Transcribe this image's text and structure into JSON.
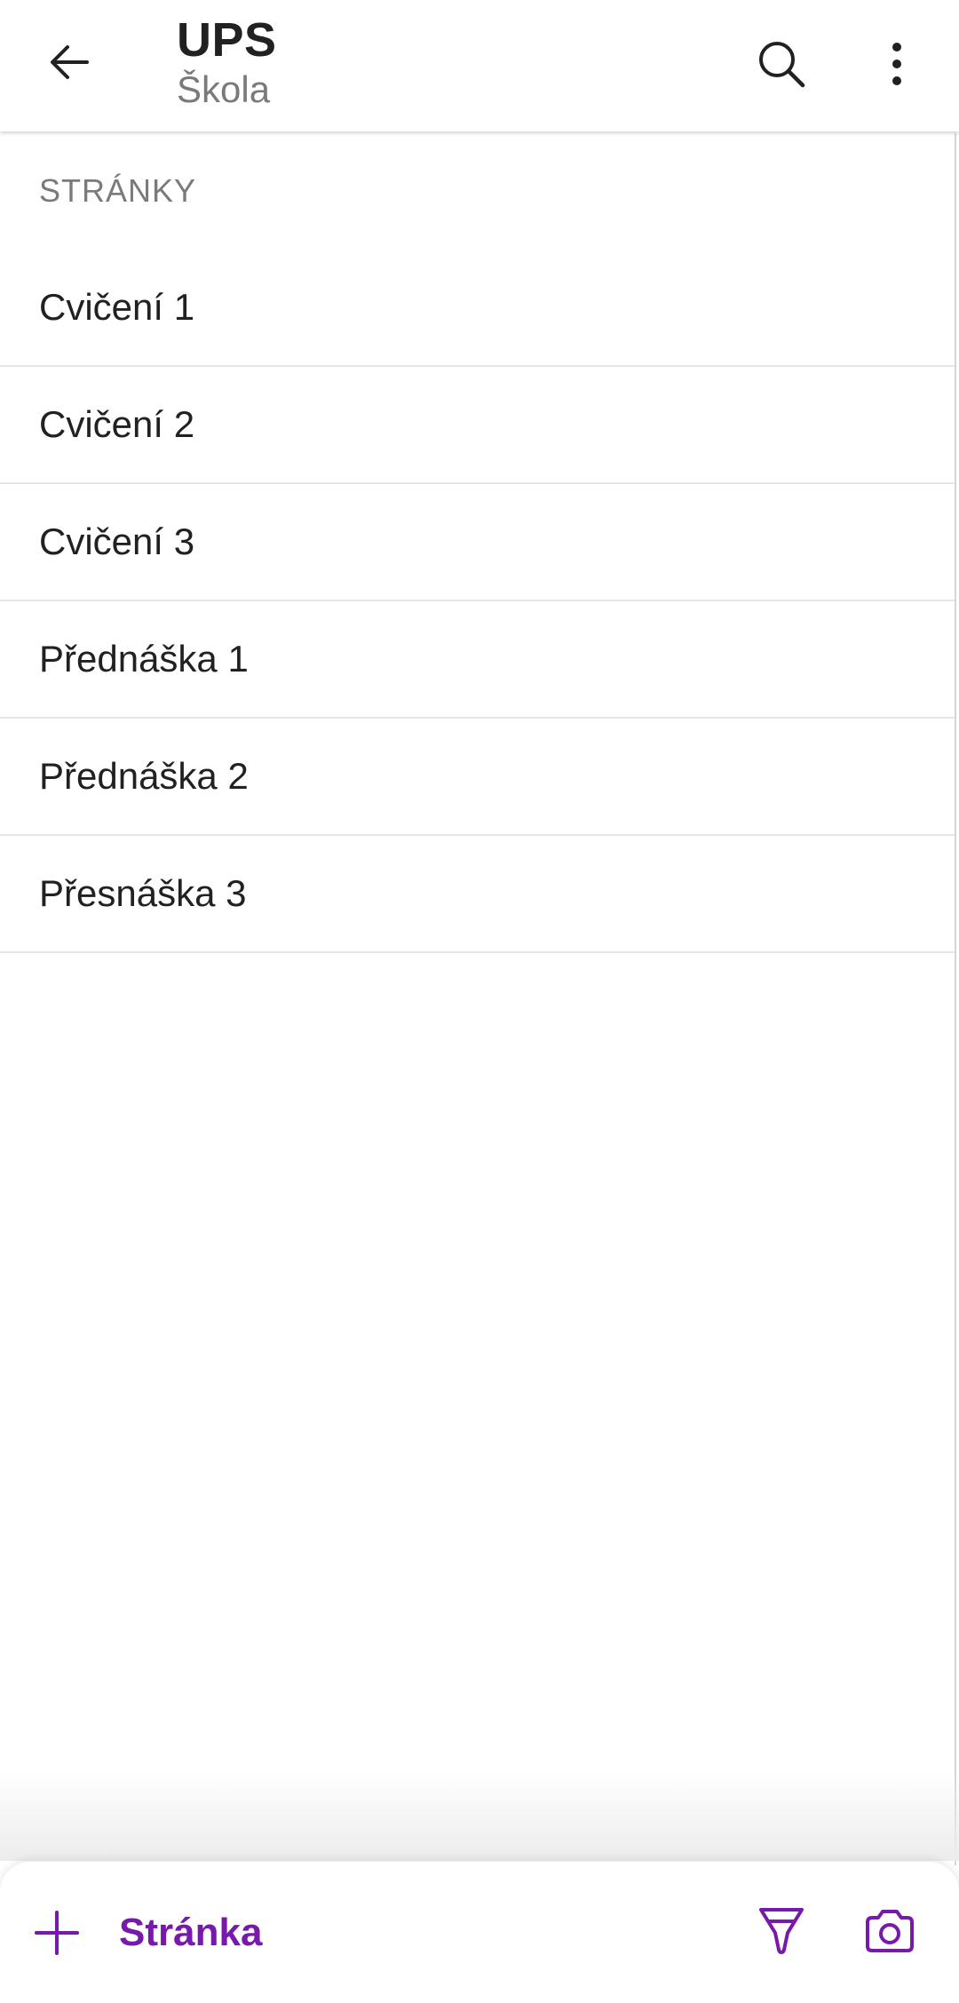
{
  "header": {
    "title": "UPS",
    "subtitle": "Škola",
    "back_icon": "arrow-left-icon",
    "search_icon": "search-icon",
    "more_icon": "more-vertical-icon"
  },
  "section": {
    "label": "STRÁNKY"
  },
  "pages": [
    {
      "label": "Cvičení 1"
    },
    {
      "label": "Cvičení 2"
    },
    {
      "label": "Cvičení 3"
    },
    {
      "label": "Přednáška 1"
    },
    {
      "label": "Přednáška 2"
    },
    {
      "label": "Přesnáška 3"
    }
  ],
  "toolbar": {
    "add_label": "Stránka",
    "add_icon": "plus-icon",
    "ink_icon": "highlighter-icon",
    "camera_icon": "camera-icon"
  },
  "colors": {
    "accent": "#7719aa",
    "text_primary": "#212121",
    "text_secondary": "#7a7a7a",
    "divider": "#e6e6e6"
  }
}
